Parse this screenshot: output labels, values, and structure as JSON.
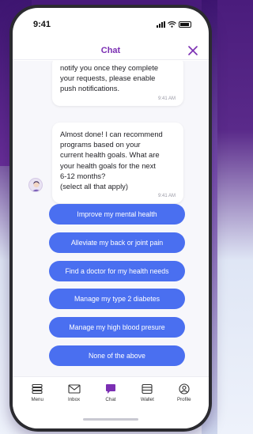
{
  "status_bar": {
    "time": "9:41"
  },
  "header": {
    "title": "Chat"
  },
  "messages": [
    {
      "text": "notify you once they complete\nyour requests, please enable\npush notifications.",
      "time": "9:41 AM"
    },
    {
      "text": "Almost done! I can recommend\nprograms based on your\ncurrent health goals. What are\nyour health goals for the next\n6-12 months?\n(select all that apply)",
      "time": "9:41 AM"
    }
  ],
  "options": [
    "Improve my mental health",
    "Alleviate my back or joint pain",
    "Find a doctor for my health needs",
    "Manage my type 2 diabetes",
    "Manage my high blood presure",
    "None of the above"
  ],
  "tabs": [
    {
      "label": "Menu",
      "icon": "menu-icon"
    },
    {
      "label": "Inbox",
      "icon": "inbox-icon"
    },
    {
      "label": "Chat",
      "icon": "chat-icon",
      "active": true
    },
    {
      "label": "Wallet",
      "icon": "wallet-icon"
    },
    {
      "label": "Profile",
      "icon": "profile-icon"
    }
  ],
  "colors": {
    "accent": "#7b2fb3",
    "option_button": "#4a6ff0",
    "background_purple": "#4a1c7c"
  }
}
